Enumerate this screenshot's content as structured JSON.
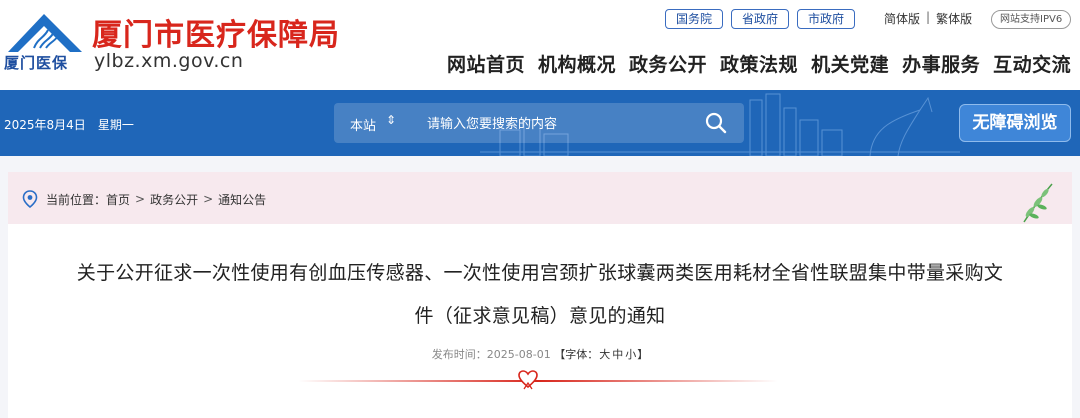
{
  "header": {
    "logo_text": "厦门医保",
    "site_name": "厦门市医疗保障局",
    "domain": "ylbz.xm.gov.cn",
    "top_links": [
      "国务院",
      "省政府",
      "市政府"
    ],
    "lang_simplified": "简体版",
    "lang_separator": "|",
    "lang_traditional": "繁体版",
    "ipv6_badge": "网站支持IPV6",
    "nav": [
      "网站首页",
      "机构概况",
      "政务公开",
      "政策法规",
      "机关党建",
      "办事服务",
      "互动交流"
    ]
  },
  "toolbar": {
    "date": "2025年8月4日",
    "weekday": "星期一",
    "search_scope": "本站",
    "search_scope_arrow": "⇕",
    "search_placeholder": "请输入您要搜索的内容",
    "accessibility_button": "无障碍浏览"
  },
  "breadcrumb": {
    "prefix": "当前位置：",
    "items": [
      "首页",
      "政务公开",
      "通知公告"
    ],
    "separator": ">"
  },
  "article": {
    "title_line1": "关于公开征求一次性使用有创血压传感器、一次性使用宫颈扩张球囊两类医用耗材全省性联盟集中带量采购文",
    "title_line2": "件（征求意见稿）意见的通知",
    "publish_label": "发布时间：",
    "publish_date": "2025-08-01",
    "font_size_label": "【字体：",
    "font_sizes": [
      "大",
      "中",
      "小"
    ],
    "font_size_close": "】"
  },
  "colors": {
    "brand_red": "#d8261c",
    "brand_blue": "#1f66b8",
    "crumb_bg": "#f7e9ee"
  }
}
